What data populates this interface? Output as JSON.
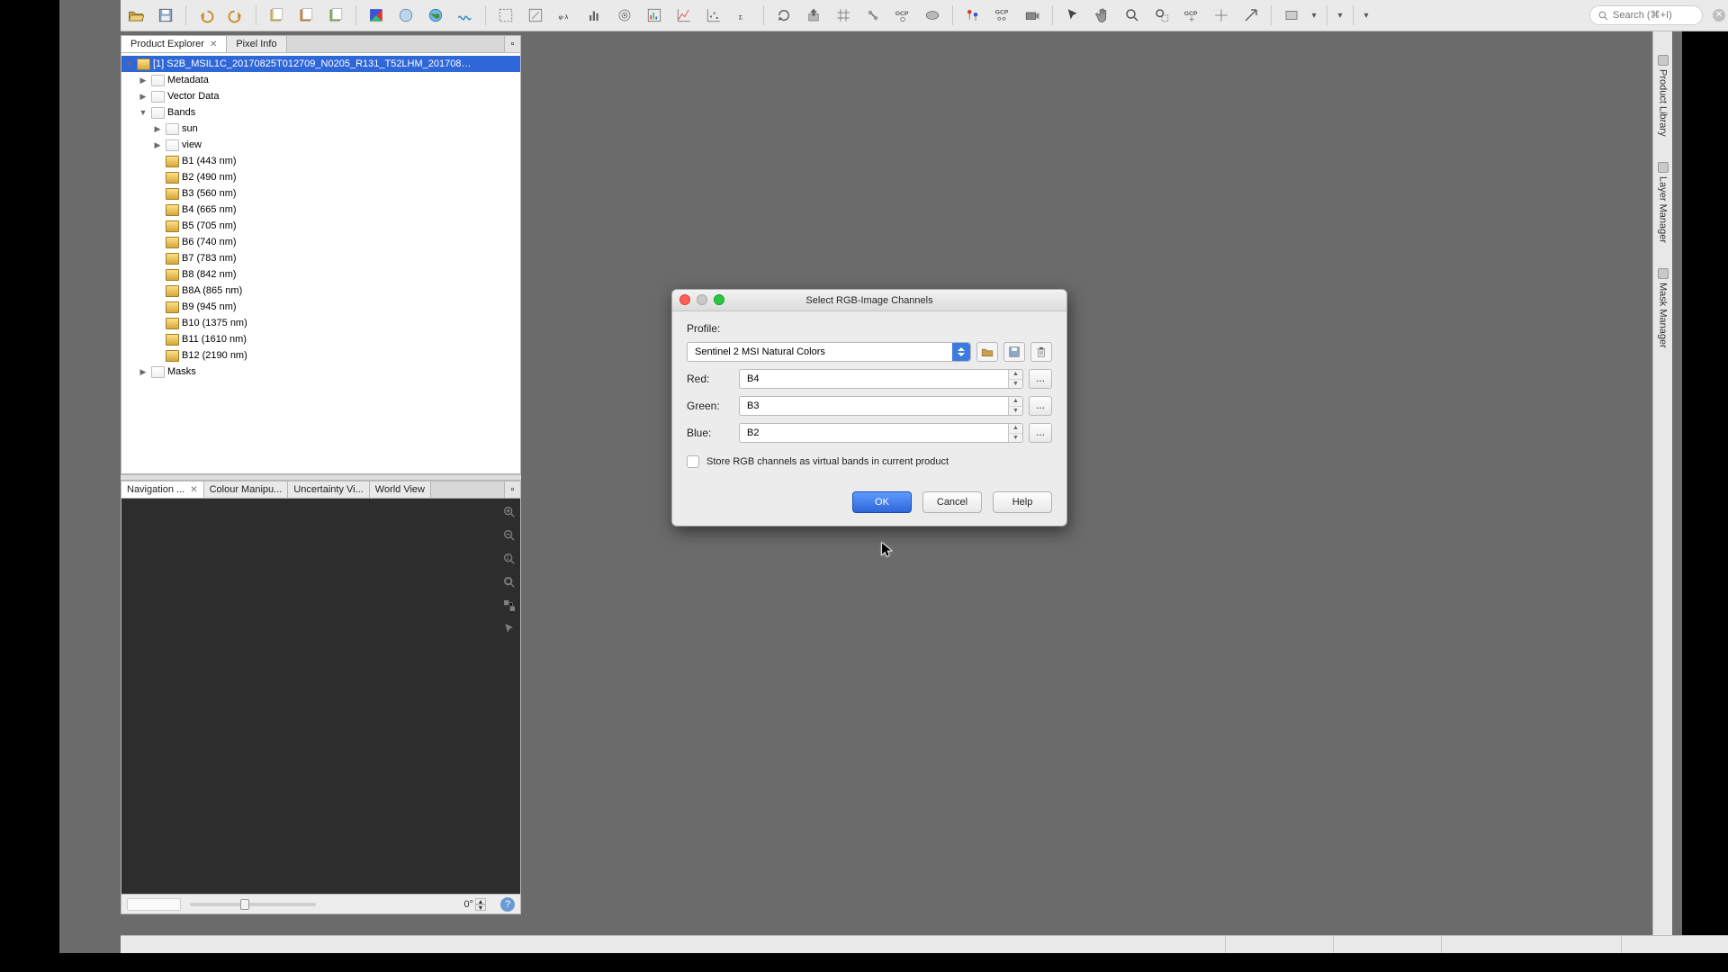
{
  "search": {
    "placeholder": "Search (⌘+I)"
  },
  "panels": {
    "top_tabs": [
      {
        "label": "Product Explorer",
        "closable": true,
        "active": true
      },
      {
        "label": "Pixel Info",
        "closable": false,
        "active": false
      }
    ],
    "bottom_tabs": [
      {
        "label": "Navigation ...",
        "closable": true,
        "active": true
      },
      {
        "label": "Colour Manipu...",
        "closable": false,
        "active": false
      },
      {
        "label": "Uncertainty Vi...",
        "closable": false,
        "active": false
      },
      {
        "label": "World View",
        "closable": false,
        "active": false
      }
    ],
    "rotation": "0°"
  },
  "tree": {
    "product": "[1] S2B_MSIL1C_20170825T012709_N0205_R131_T52LHM_201708…",
    "nodes": [
      {
        "label": "Metadata",
        "depth": 1,
        "type": "folder",
        "tw": "▶"
      },
      {
        "label": "Vector Data",
        "depth": 1,
        "type": "folder",
        "tw": "▶"
      },
      {
        "label": "Bands",
        "depth": 1,
        "type": "folder",
        "tw": "▼"
      },
      {
        "label": "sun",
        "depth": 2,
        "type": "folder",
        "tw": "▶"
      },
      {
        "label": "view",
        "depth": 2,
        "type": "folder",
        "tw": "▶"
      },
      {
        "label": "B1 (443 nm)",
        "depth": 2,
        "type": "band",
        "tw": ""
      },
      {
        "label": "B2 (490 nm)",
        "depth": 2,
        "type": "band",
        "tw": ""
      },
      {
        "label": "B3 (560 nm)",
        "depth": 2,
        "type": "band",
        "tw": ""
      },
      {
        "label": "B4 (665 nm)",
        "depth": 2,
        "type": "band",
        "tw": ""
      },
      {
        "label": "B5 (705 nm)",
        "depth": 2,
        "type": "band",
        "tw": ""
      },
      {
        "label": "B6 (740 nm)",
        "depth": 2,
        "type": "band",
        "tw": ""
      },
      {
        "label": "B7 (783 nm)",
        "depth": 2,
        "type": "band",
        "tw": ""
      },
      {
        "label": "B8 (842 nm)",
        "depth": 2,
        "type": "band",
        "tw": ""
      },
      {
        "label": "B8A (865 nm)",
        "depth": 2,
        "type": "band",
        "tw": ""
      },
      {
        "label": "B9 (945 nm)",
        "depth": 2,
        "type": "band",
        "tw": ""
      },
      {
        "label": "B10 (1375 nm)",
        "depth": 2,
        "type": "band",
        "tw": ""
      },
      {
        "label": "B11 (1610 nm)",
        "depth": 2,
        "type": "band",
        "tw": ""
      },
      {
        "label": "B12 (2190 nm)",
        "depth": 2,
        "type": "band",
        "tw": ""
      },
      {
        "label": "Masks",
        "depth": 1,
        "type": "folder",
        "tw": "▶"
      }
    ]
  },
  "right_dock": [
    "Product Library",
    "Layer Manager",
    "Mask Manager"
  ],
  "dialog": {
    "title": "Select RGB-Image Channels",
    "profile_label": "Profile:",
    "profile_value": "Sentinel 2 MSI Natural Colors",
    "channels": [
      {
        "label": "Red:",
        "value": "B4"
      },
      {
        "label": "Green:",
        "value": "B3"
      },
      {
        "label": "Blue:",
        "value": "B2"
      }
    ],
    "checkbox_label": "Store RGB channels as virtual bands in current product",
    "buttons": {
      "ok": "OK",
      "cancel": "Cancel",
      "help": "Help"
    }
  },
  "toolbar_icons": [
    "open",
    "save",
    "sep",
    "undo",
    "redo",
    "sep",
    "layer1",
    "layer2",
    "layer3",
    "sep",
    "flag-red",
    "flag-gray",
    "globe",
    "wave",
    "sep",
    "roi",
    "edit",
    "phi",
    "hist",
    "target",
    "ts",
    "graph",
    "line",
    "sigma",
    "sep",
    "refresh",
    "export",
    "grid",
    "link",
    "gcp",
    "mask",
    "sep",
    "pins",
    "gcps",
    "camera",
    "sep",
    "arrow",
    "hand",
    "zoom",
    "zoomroi",
    "gcp2",
    "cross",
    "nav",
    "sep",
    "square",
    "drop",
    "sep",
    "drop",
    "sep",
    "drop"
  ]
}
